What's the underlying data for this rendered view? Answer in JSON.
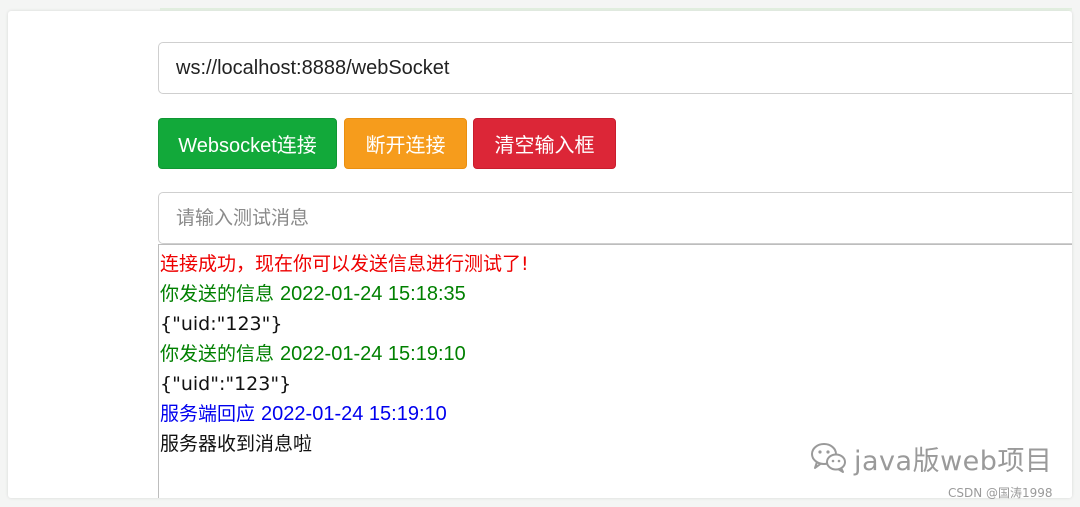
{
  "websocket_url": "ws://localhost:8888/webSocket",
  "buttons": {
    "connect_label": "Websocket连接",
    "disconnect_label": "断开连接",
    "clear_label": "清空输入框"
  },
  "message_input": {
    "value": "",
    "placeholder": "请输入测试消息"
  },
  "log": [
    {
      "text": "连接成功，现在你可以发送信息进行测试了!",
      "time": "",
      "color": "#ee0000"
    },
    {
      "text": "你发送的信息 ",
      "time": "2022-01-24 15:18:35",
      "color": "#008000"
    },
    {
      "text": "{\"uid:\"123\"}",
      "time": "",
      "color": "#111111"
    },
    {
      "text": "你发送的信息 ",
      "time": "2022-01-24 15:19:10",
      "color": "#008000"
    },
    {
      "text": "{\"uid\":\"123\"}",
      "time": "",
      "color": "#111111"
    },
    {
      "text": "服务端回应 ",
      "time": "2022-01-24 15:19:10",
      "color": "#0000ee"
    },
    {
      "text": "服务器收到消息啦",
      "time": "",
      "color": "#111111"
    }
  ],
  "watermark": {
    "icon": "wechat-icon",
    "text": "java版web项目"
  },
  "footer_credit": "CSDN @国涛1998",
  "colors": {
    "connect": "#12a93a",
    "disconnect": "#f69c1c",
    "clear": "#dc2637"
  }
}
